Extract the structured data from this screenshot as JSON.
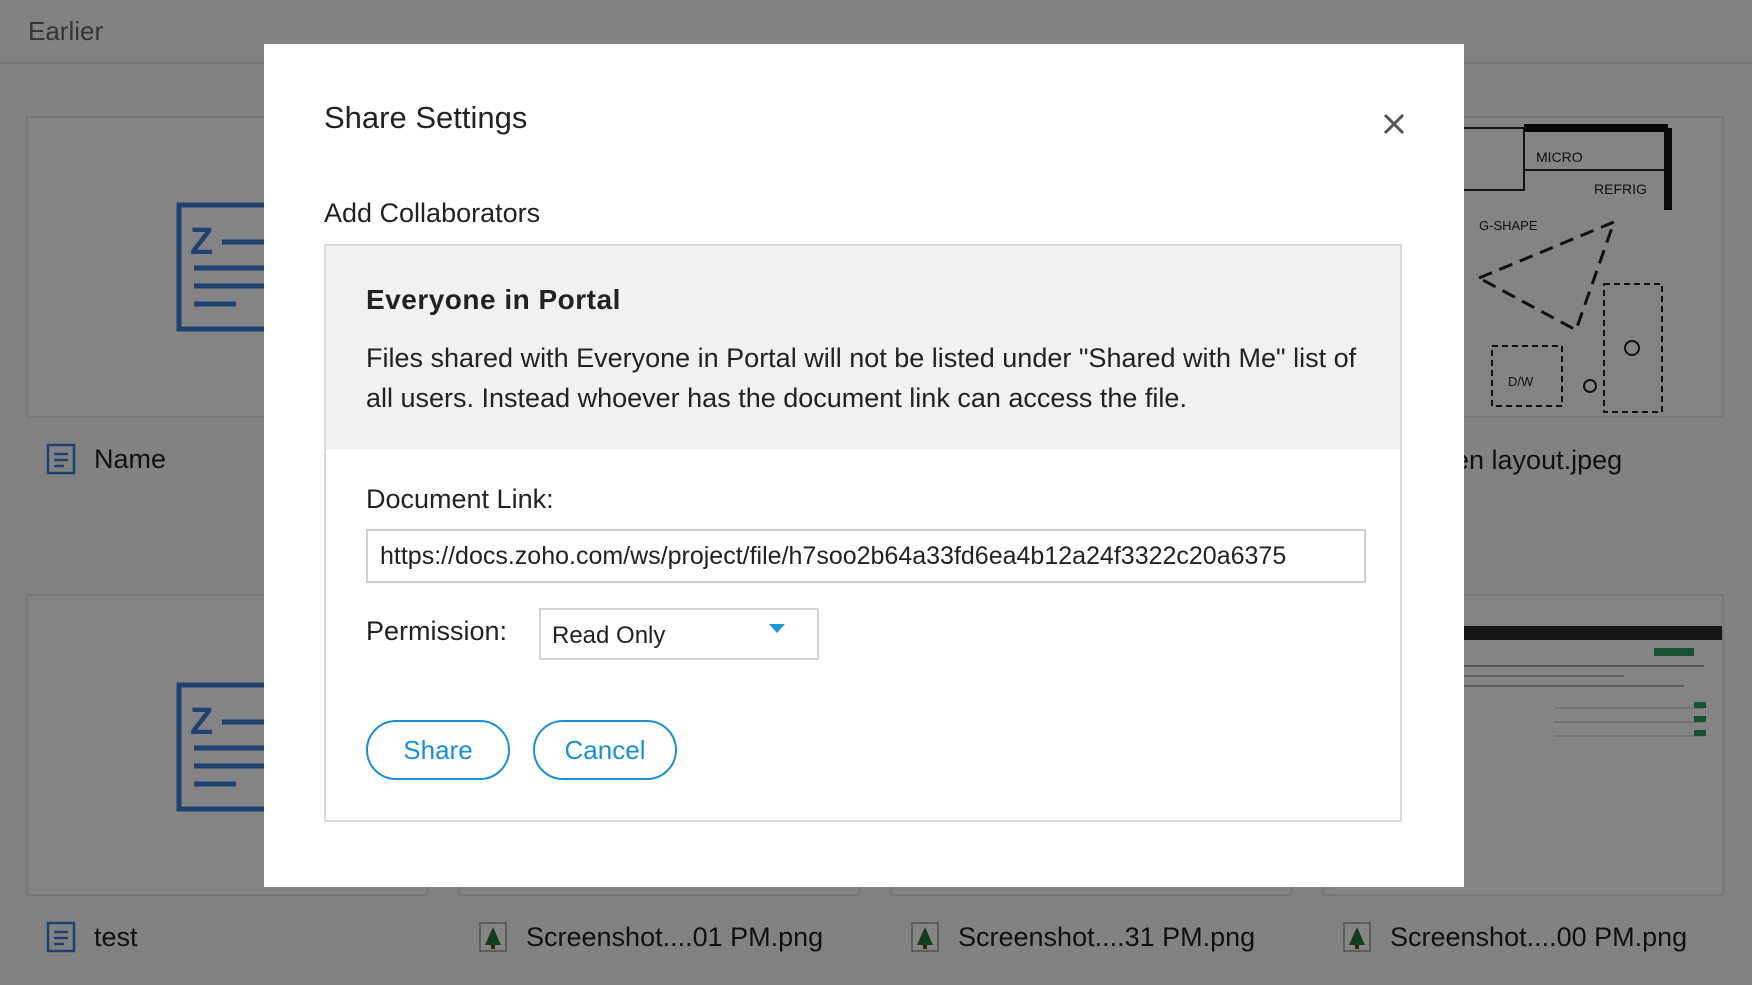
{
  "background": {
    "section_title": "Earlier",
    "files": [
      {
        "name": "Name",
        "type": "doc"
      },
      {
        "name": "en layout.jpeg",
        "type": "image"
      },
      {
        "name": "test",
        "type": "doc"
      },
      {
        "name": "Screenshot....01 PM.png",
        "type": "image"
      },
      {
        "name": "Screenshot....31 PM.png",
        "type": "image"
      },
      {
        "name": "Screenshot....00 PM.png",
        "type": "image"
      }
    ],
    "floorplan_labels": [
      "MICRO",
      "REFRIG",
      "G-SHAPE",
      "D/W"
    ]
  },
  "dialog": {
    "title": "Share Settings",
    "close_icon": "close-icon",
    "section_label": "Add Collaborators",
    "notice": {
      "title": "Everyone in Portal",
      "text": "Files shared with Everyone in Portal will not be listed under \"Shared with Me\" list of all users. Instead whoever has the document link can access the file."
    },
    "document_link": {
      "label": "Document Link:",
      "value": "https://docs.zoho.com/ws/project/file/h7soo2b64a33fd6ea4b12a24f3322c20a6375"
    },
    "permission": {
      "label": "Permission:",
      "selected": "Read Only"
    },
    "buttons": {
      "share": "Share",
      "cancel": "Cancel"
    }
  },
  "colors": {
    "accent": "#1a8fd6",
    "overlay": "rgba(0,0,0,0.48)",
    "notice_bg": "#f1f1f2",
    "doc_icon": "#3d7ed8",
    "image_icon": "#1d7a3a"
  }
}
